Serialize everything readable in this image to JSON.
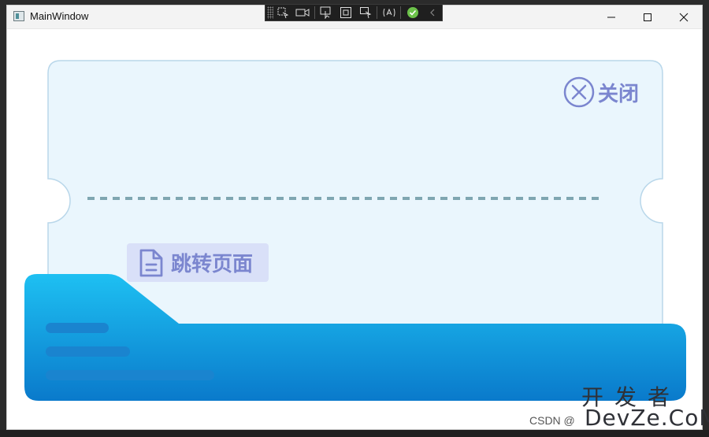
{
  "window": {
    "title": "MainWindow",
    "controls": [
      "minimize-icon",
      "maximize-icon",
      "close-icon"
    ]
  },
  "debug_toolbar": {
    "tools": [
      "select-element-icon",
      "record-icon",
      "pointer-icon",
      "adorner-icon",
      "track-focus-icon",
      "hot-reload-icon",
      "check-icon",
      "collapse-chevron-icon"
    ],
    "status_color": "#6cc24a"
  },
  "ticket": {
    "close_label": "关闭",
    "jump_label": "跳转页面",
    "background_color": "#eaf6fd",
    "border_color": "#b9d7ea",
    "dash_color": "#7fa6b1",
    "accent_color": "#7b86cf"
  },
  "folder": {
    "gradient_top": "#1ec0f2",
    "gradient_bottom": "#0a7acb",
    "line_color": "#1a84cf"
  },
  "watermark": {
    "top_text": "开发者",
    "brand_text": "DevZe.CoM",
    "bottom_text": "CSDN @"
  }
}
